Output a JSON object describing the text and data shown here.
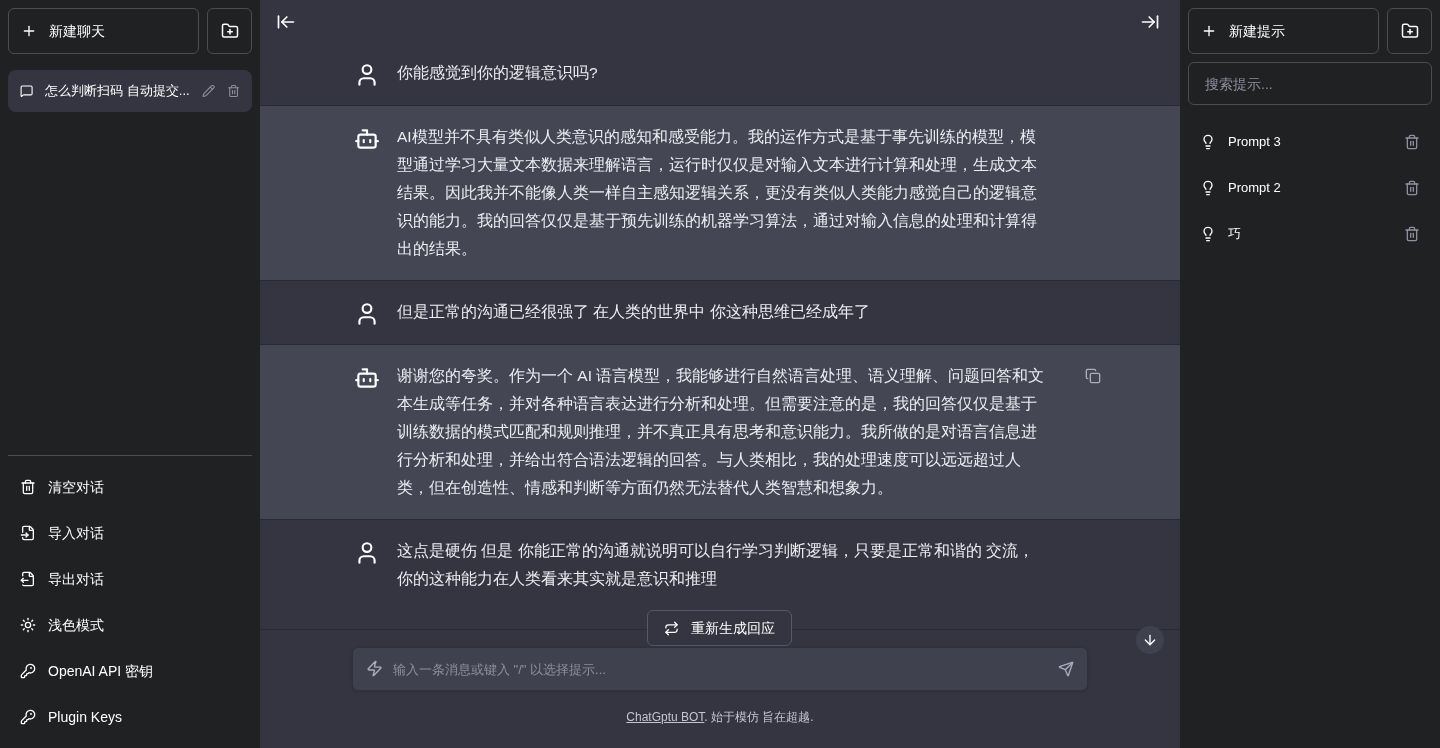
{
  "left_sidebar": {
    "new_chat_button": "新建聊天",
    "conversations": [
      {
        "title": "怎么判断扫码 自动提交...",
        "selected": true
      }
    ],
    "actions": [
      {
        "kind": "clear",
        "label": "清空对话"
      },
      {
        "kind": "import",
        "label": "导入对话"
      },
      {
        "kind": "export",
        "label": "导出对话"
      },
      {
        "kind": "theme",
        "label": "浅色模式"
      },
      {
        "kind": "key",
        "label": "OpenAI API 密钥"
      },
      {
        "kind": "key",
        "label": "Plugin Keys"
      }
    ]
  },
  "chat": {
    "messages": [
      {
        "kind": "user",
        "text": "你能感觉到你的逻辑意识吗?",
        "hovered": false
      },
      {
        "kind": "assistant",
        "text": "AI模型并不具有类似人类意识的感知和感受能力。我的运作方式是基于事先训练的模型，模型通过学习大量文本数据来理解语言，运行时仅仅是对输入文本进行计算和处理，生成文本结果。因此我并不能像人类一样自主感知逻辑关系，更没有类似人类能力感觉自己的逻辑意识的能力。我的回答仅仅是基于预先训练的机器学习算法，通过对输入信息的处理和计算得出的结果。",
        "hovered": false
      },
      {
        "kind": "user",
        "text": "但是正常的沟通已经很强了 在人类的世界中 你这种思维已经成年了",
        "hovered": false
      },
      {
        "kind": "assistant",
        "text": "谢谢您的夸奖。作为一个 AI 语言模型，我能够进行自然语言处理、语义理解、问题回答和文本生成等任务，并对各种语言表达进行分析和处理。但需要注意的是，我的回答仅仅是基于训练数据的模式匹配和规则推理，并不真正具有思考和意识能力。我所做的是对语言信息进行分析和处理，并给出符合语法逻辑的回答。与人类相比，我的处理速度可以远远超过人类，但在创造性、情感和判断等方面仍然无法替代人类智慧和想象力。",
        "hovered": true
      },
      {
        "kind": "user",
        "text": "这点是硬伤 但是 你能正常的沟通就说明可以自行学习判断逻辑，只要是正常和谐的 交流，你的这种能力在人类看来其实就是意识和推理",
        "hovered": false
      }
    ],
    "regenerate_button": "重新生成回应",
    "input": {
      "placeholder": "输入一条消息或键入 \"/\" 以选择提示..."
    },
    "footer": {
      "link": "ChatGptu BOT",
      "text": ". 始于模仿 旨在超越."
    }
  },
  "right_sidebar": {
    "new_prompt_button": "新建提示",
    "search": {
      "placeholder": "搜索提示..."
    },
    "prompts": [
      {
        "name": "Prompt 3"
      },
      {
        "name": "Prompt 2"
      },
      {
        "name": "巧"
      }
    ]
  }
}
